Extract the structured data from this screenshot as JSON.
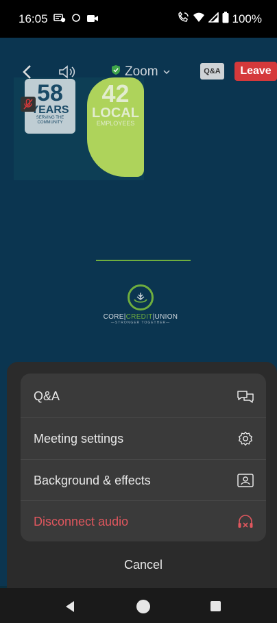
{
  "status_bar": {
    "time": "16:05",
    "battery": "100%",
    "icons": [
      "notification-icon",
      "circle-icon",
      "video-icon",
      "wifi-call-icon",
      "wifi-icon",
      "signal-icon",
      "battery-icon"
    ]
  },
  "meeting": {
    "title": "Zoom",
    "qa_label": "Q&A",
    "leave_label": "Leave"
  },
  "shared_content": {
    "years_number": "58",
    "years_word": "YEARS",
    "years_sub": "SERVING THE COMMUNITY",
    "local_number": "42",
    "local_word": "LOCAL",
    "local_sub": "EMPLOYEES",
    "logo_core": "CORE",
    "logo_credit": "CREDIT",
    "logo_union": "UNION",
    "logo_tagline": "—STRONGER TOGETHER—"
  },
  "menu": {
    "items": [
      {
        "label": "Q&A",
        "icon": "qa-chat-icon"
      },
      {
        "label": "Meeting settings",
        "icon": "gear-icon"
      },
      {
        "label": "Background & effects",
        "icon": "background-portrait-icon"
      },
      {
        "label": "Disconnect audio",
        "icon": "headphones-disconnect-icon"
      }
    ],
    "cancel_label": "Cancel"
  },
  "colors": {
    "accent_leave": "#d5393b",
    "danger_text": "#e0575e",
    "brand_green": "#6fae3e"
  }
}
